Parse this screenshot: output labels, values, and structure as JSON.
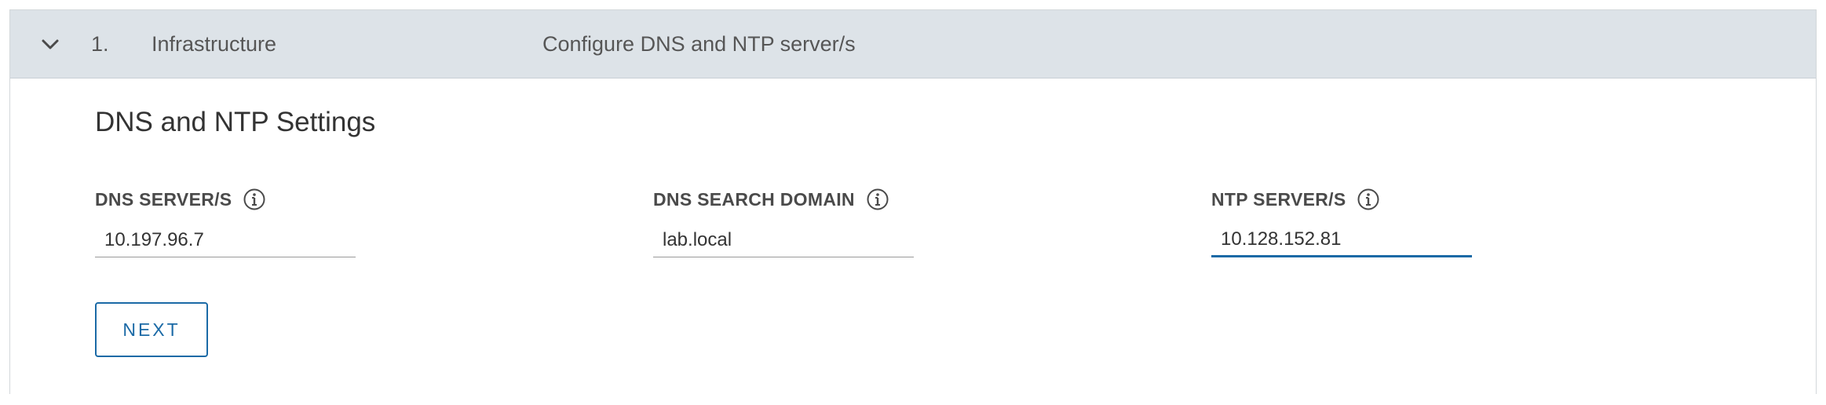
{
  "step": {
    "number": "1.",
    "title": "Infrastructure",
    "description": "Configure DNS and NTP server/s",
    "expanded": true
  },
  "section": {
    "title": "DNS and NTP Settings"
  },
  "fields": {
    "dns_servers": {
      "label": "DNS SERVER/S",
      "value": "10.197.96.7"
    },
    "dns_search_domain": {
      "label": "DNS SEARCH DOMAIN",
      "value": "lab.local"
    },
    "ntp_servers": {
      "label": "NTP SERVER/S",
      "value": "10.128.152.81",
      "focused": true
    }
  },
  "actions": {
    "next_label": "NEXT"
  },
  "icons": {
    "toggle": "chevron-down-icon",
    "info": "info-icon"
  },
  "colors": {
    "header_bg": "#dde3e8",
    "accent": "#1b6aa6",
    "text": "#333333"
  }
}
